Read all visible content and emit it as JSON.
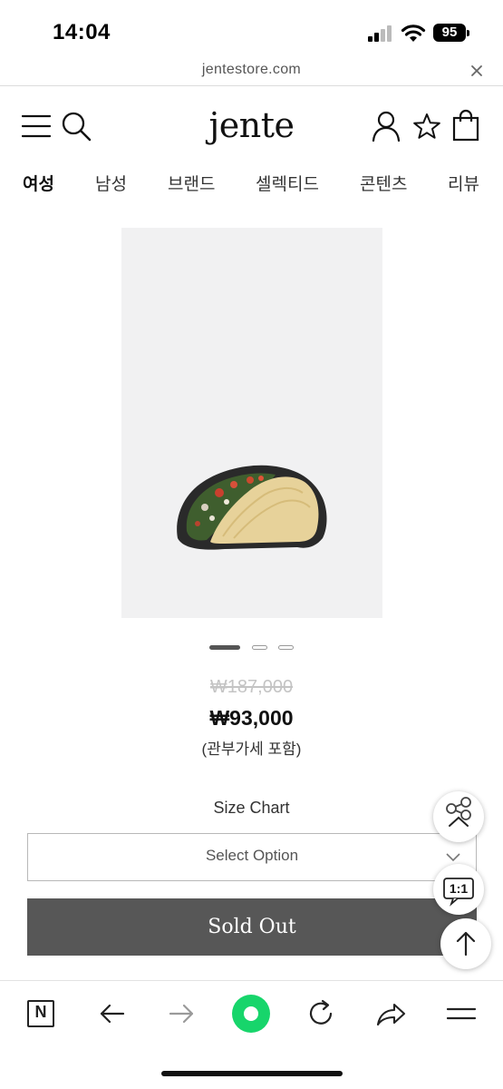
{
  "status_bar": {
    "time": "14:04",
    "battery": "95",
    "icons": [
      "signal-icon",
      "wifi-icon",
      "battery-icon"
    ]
  },
  "url_bar": {
    "domain": "jentestore.com",
    "close_icon": "close-icon"
  },
  "header": {
    "logo": "jente",
    "icons": [
      "menu-icon",
      "search-icon",
      "user-icon",
      "star-icon",
      "shopping-bag-icon"
    ]
  },
  "category_nav": {
    "items": [
      {
        "label": "여성",
        "active": true
      },
      {
        "label": "남성",
        "active": false
      },
      {
        "label": "브랜드",
        "active": false
      },
      {
        "label": "셀렉티드",
        "active": false
      },
      {
        "label": "콘텐츠",
        "active": false
      },
      {
        "label": "리뷰",
        "active": false
      }
    ]
  },
  "product": {
    "image_icon": "taco-image",
    "pager": {
      "total": 3,
      "current": 1
    },
    "original_price": "₩187,000",
    "sale_price": "₩93,000",
    "tax_note": "(관부가세 포함)",
    "size_chart_label": "Size Chart",
    "select_placeholder": "Select Option",
    "sold_out_label": "Sold Out"
  },
  "floating_buttons": {
    "share_icon": "share-icon",
    "chat_label": "1:1",
    "top_icon": "arrow-up-icon"
  },
  "browser_toolbar": {
    "icons": [
      "naver-n-icon",
      "back-arrow-icon",
      "forward-arrow-icon",
      "green-home-icon",
      "reload-icon",
      "share-arrow-icon",
      "hamburger-menu-icon"
    ],
    "n_label": "N"
  },
  "colors": {
    "sold_out_bg": "#575757",
    "green_button": "#17d56b",
    "original_price": "#c4c4c4"
  }
}
